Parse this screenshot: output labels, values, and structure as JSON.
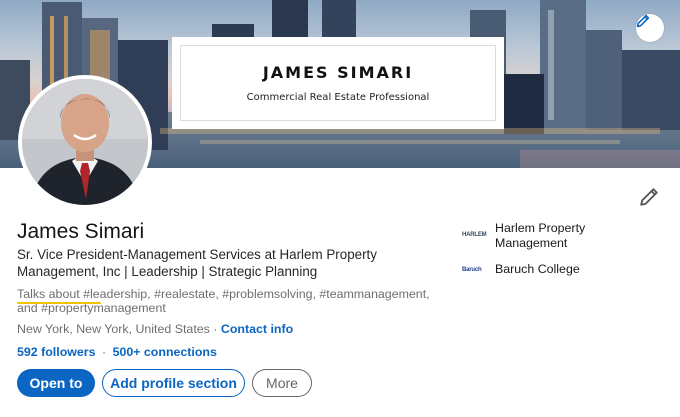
{
  "banner": {
    "title_card_name": "JAMES SIMARI",
    "title_card_subtitle": "Commercial Real Estate Professional"
  },
  "profile": {
    "name": "James Simari",
    "headline": "Sr. Vice President-Management Services at Harlem Property Management, Inc | Leadership | Strategic Planning",
    "talks_about": "Talks about #leadership, #realestate, #problemsolving, #teammanagement, and #propertymanagement",
    "location": "New York, New York, United States",
    "contact_info_label": "Contact info",
    "followers_label": "592 followers",
    "connections_label": "500+ connections"
  },
  "actions": {
    "open_to": "Open to",
    "add_section": "Add profile section",
    "more": "More"
  },
  "experience": [
    {
      "logo_text": "HARLEM",
      "label_line1": "Harlem Property",
      "label_line2": "Management"
    },
    {
      "logo_text": "Baruch",
      "label_line1": "Baruch College",
      "label_line2": ""
    }
  ],
  "icons": {
    "banner_edit": "pencil-icon",
    "profile_edit": "pencil-icon"
  },
  "colors": {
    "primary": "#0a66c2",
    "highlight": "#f3c300",
    "muted_text": "#6b6b6b"
  }
}
